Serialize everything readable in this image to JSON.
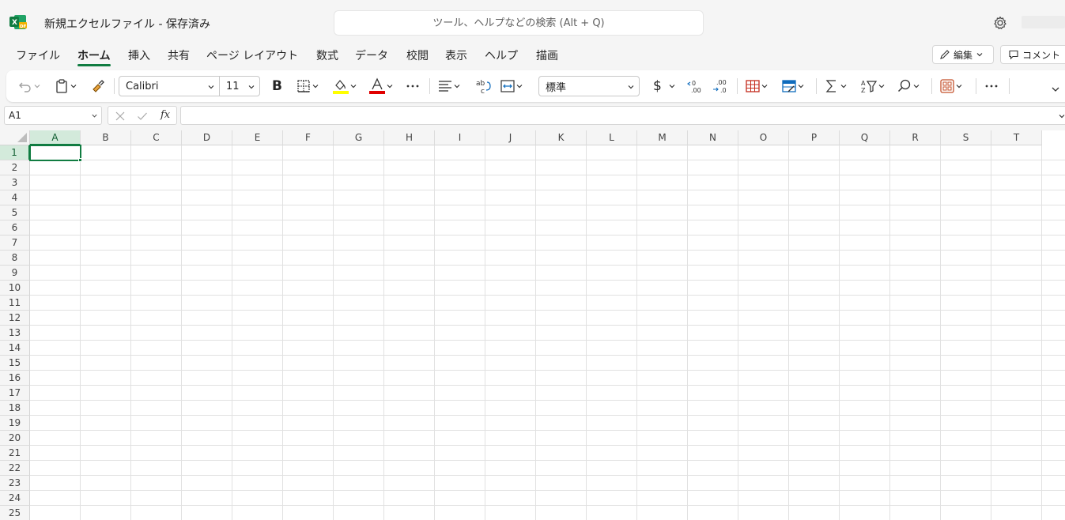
{
  "app": {
    "icon": "excel-logo-icon",
    "brand_color": "#107c41"
  },
  "title": {
    "document": "新規エクセルファイル",
    "separator": "-",
    "status": "保存済み",
    "full": "新規エクセルファイル - 保存済み"
  },
  "search": {
    "placeholder": "ツール、ヘルプなどの検索 (Alt + Q)"
  },
  "tabs": [
    {
      "label": "ファイル",
      "active": false
    },
    {
      "label": "ホーム",
      "active": true
    },
    {
      "label": "挿入",
      "active": false
    },
    {
      "label": "共有",
      "active": false
    },
    {
      "label": "ページ レイアウト",
      "active": false
    },
    {
      "label": "数式",
      "active": false
    },
    {
      "label": "データ",
      "active": false
    },
    {
      "label": "校閲",
      "active": false
    },
    {
      "label": "表示",
      "active": false
    },
    {
      "label": "ヘルプ",
      "active": false
    },
    {
      "label": "描画",
      "active": false
    }
  ],
  "actions": {
    "edit_label": "編集",
    "comment_label": "コメント"
  },
  "ribbon": {
    "font_name": "Calibri",
    "font_size": "11",
    "number_format": "標準",
    "bold_label": "B",
    "currency_symbol": "$",
    "highlight_color": "#ffff00",
    "font_color": "#e00000"
  },
  "formula_bar": {
    "name_box": "A1",
    "fx_label": "fx",
    "formula": ""
  },
  "sheet": {
    "columns": [
      "A",
      "B",
      "C",
      "D",
      "E",
      "F",
      "G",
      "H",
      "I",
      "J",
      "K",
      "L",
      "M",
      "N",
      "O",
      "P",
      "Q",
      "R",
      "S",
      "T"
    ],
    "rows": [
      "1",
      "2",
      "3",
      "4",
      "5",
      "6",
      "7",
      "8",
      "9",
      "10",
      "11",
      "12",
      "13",
      "14",
      "15",
      "16",
      "17",
      "18",
      "19",
      "20",
      "21",
      "22",
      "23",
      "24",
      "25"
    ],
    "selected_cell": "A1"
  }
}
